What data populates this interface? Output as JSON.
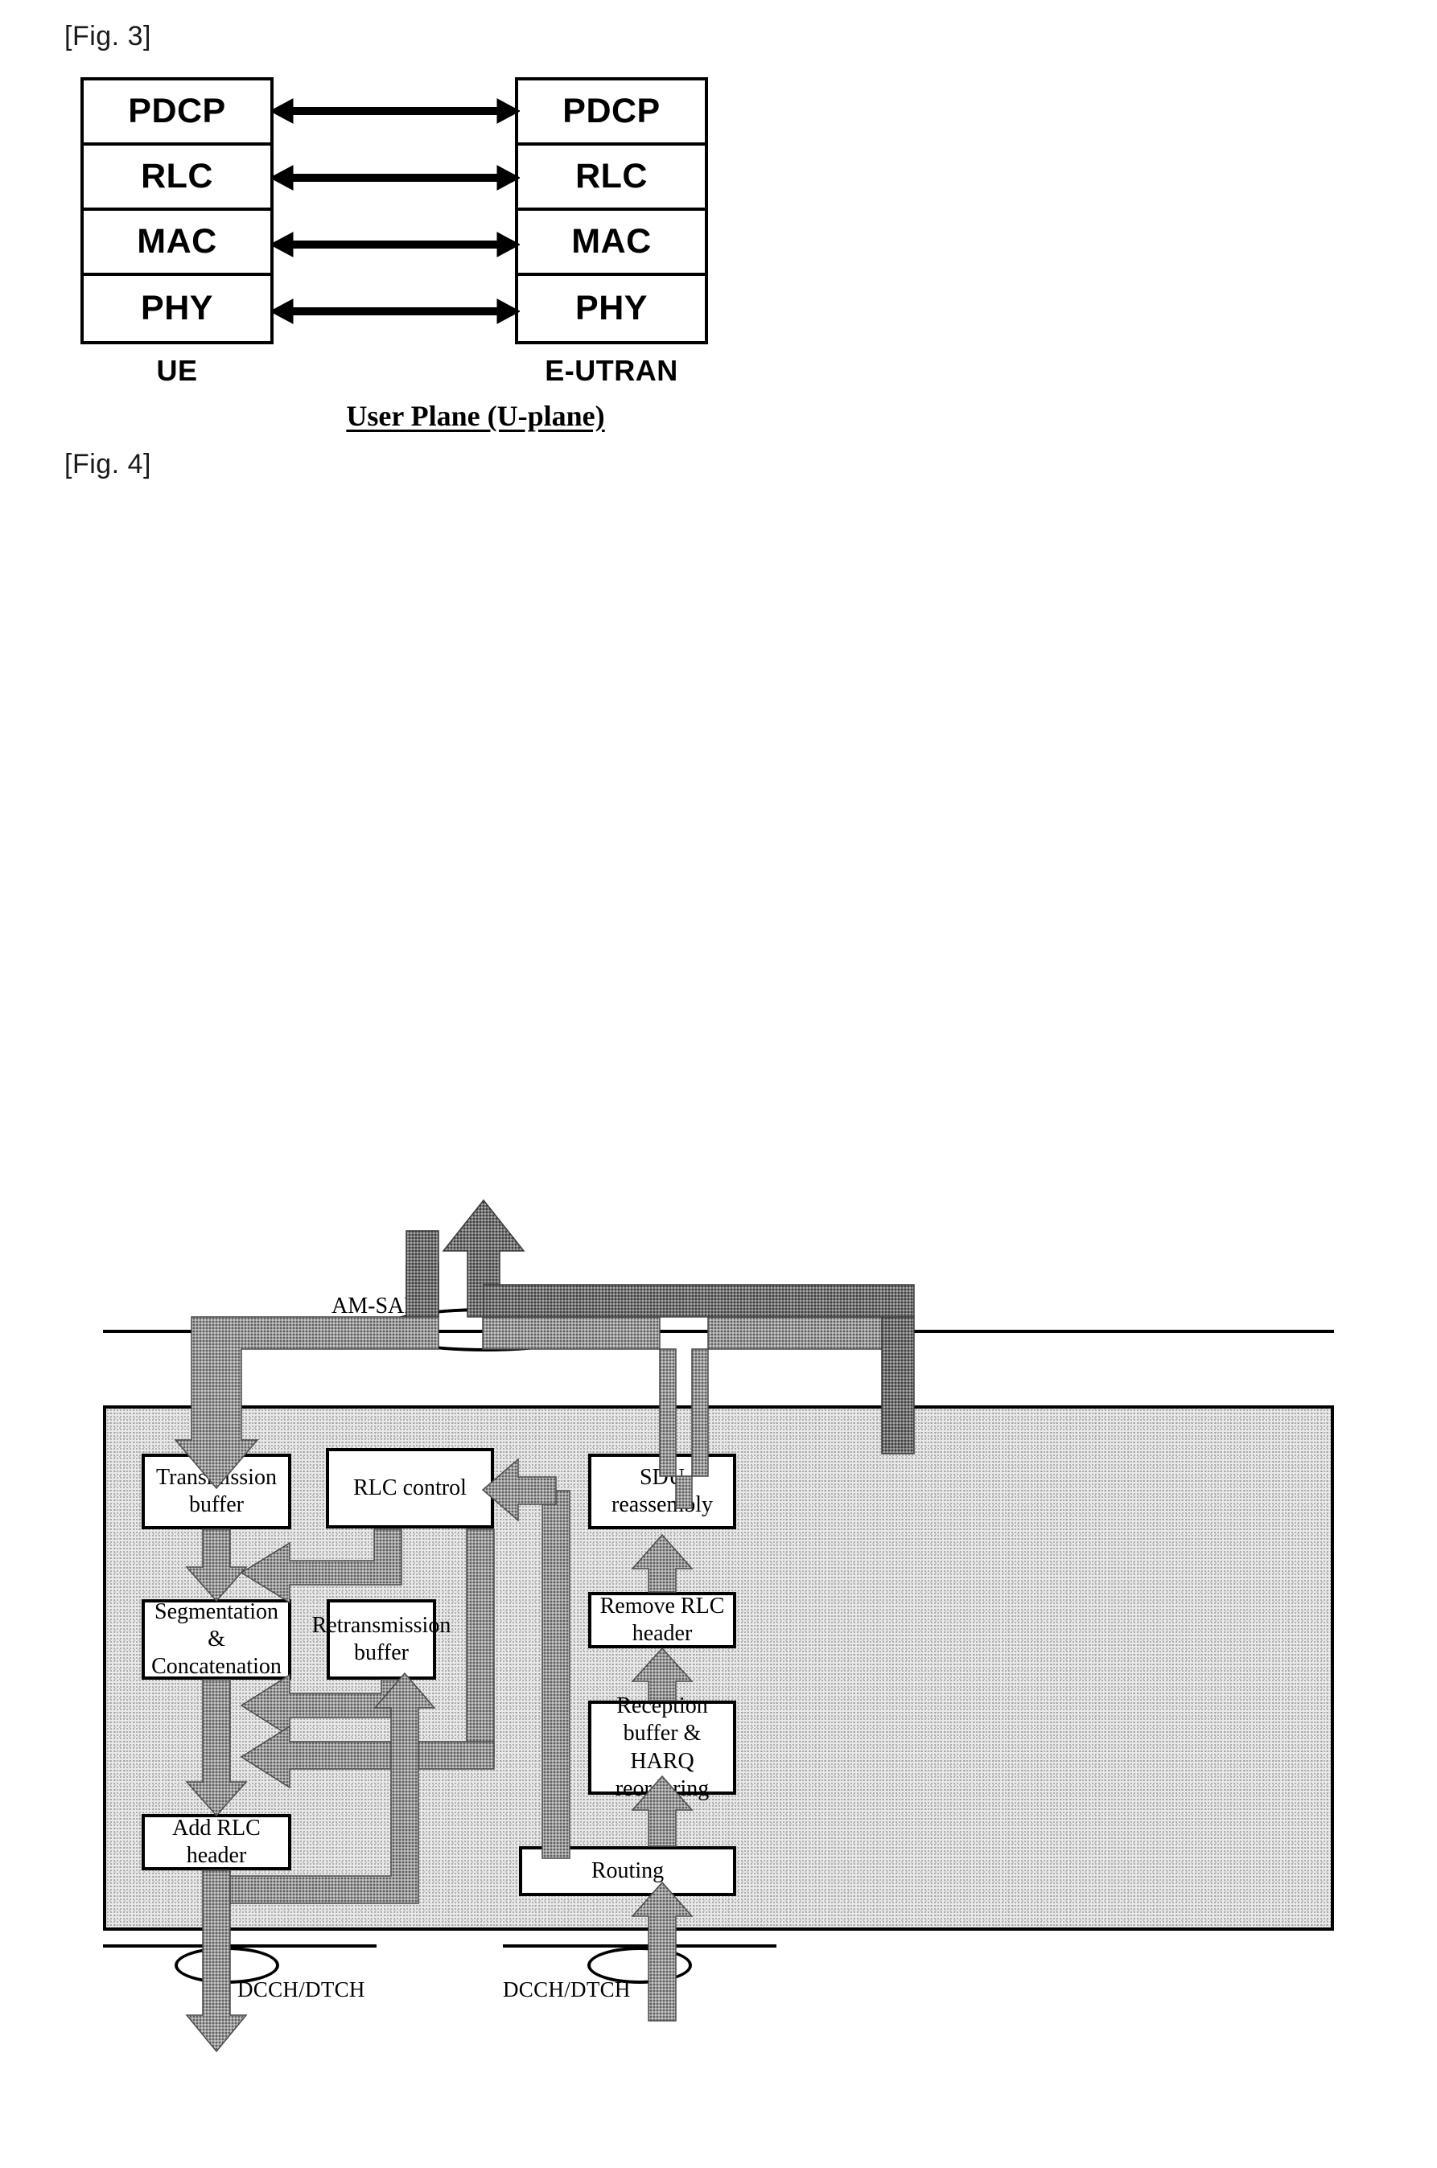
{
  "figures": [
    {
      "tag": "[Fig. 3]",
      "caption": "User Plane (U-plane)",
      "left_stack": {
        "node_label": "UE",
        "layers": [
          "PDCP",
          "RLC",
          "MAC",
          "PHY"
        ]
      },
      "right_stack": {
        "node_label": "E-UTRAN",
        "layers": [
          "PDCP",
          "RLC",
          "MAC",
          "PHY"
        ]
      },
      "connectors": [
        {
          "name": "pdcp-peer-link",
          "layer": "PDCP",
          "type": "bidirectional"
        },
        {
          "name": "rlc-peer-link",
          "layer": "RLC",
          "type": "bidirectional"
        },
        {
          "name": "mac-peer-link",
          "layer": "MAC",
          "type": "bidirectional"
        },
        {
          "name": "phy-peer-link",
          "layer": "PHY",
          "type": "bidirectional"
        }
      ]
    },
    {
      "tag": "[Fig. 4]",
      "sap_label": "AM-SAP",
      "channel_label_left": "DCCH/DTCH",
      "channel_label_right": "DCCH/DTCH",
      "blocks": {
        "transmission_buffer": "Transmission\nbuffer",
        "transmission_buffer_line1": "Transmission",
        "transmission_buffer_line2": "buffer",
        "rlc_control": "RLC control",
        "sdu_reassembly": "SDU reassembly",
        "segmentation_concatenation_line1": "Segmentation &",
        "segmentation_concatenation_line2": "Concatenation",
        "retransmission_buffer_line1": "Retransmission",
        "retransmission_buffer_line2": "buffer",
        "remove_rlc_header": "Remove RLC header",
        "reception_buffer_line1": "Reception",
        "reception_buffer_line2": "buffer & HARQ",
        "reception_buffer_line3": "reordering",
        "add_rlc_header": "Add RLC header",
        "routing": "Routing"
      }
    }
  ],
  "colors": {
    "ink": "#000000",
    "page": "#ffffff",
    "entity_fill": "#e9e9e9",
    "arrow_fill": "#8c8c8c"
  }
}
